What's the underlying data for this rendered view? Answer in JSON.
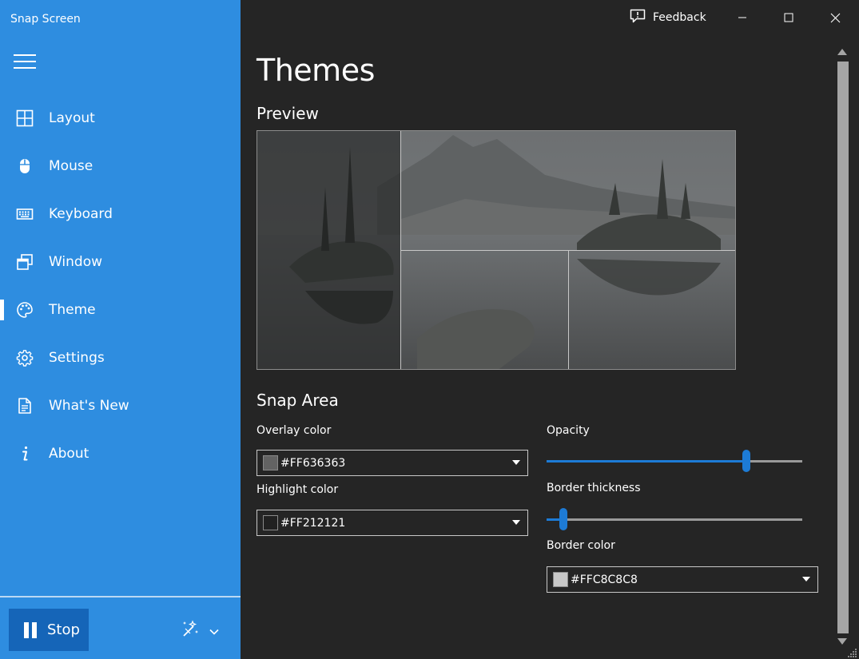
{
  "app": {
    "title": "Snap Screen"
  },
  "sidebar": {
    "items": [
      {
        "label": "Layout",
        "icon": "layout-grid-icon"
      },
      {
        "label": "Mouse",
        "icon": "mouse-icon"
      },
      {
        "label": "Keyboard",
        "icon": "keyboard-icon"
      },
      {
        "label": "Window",
        "icon": "window-icon"
      },
      {
        "label": "Theme",
        "icon": "palette-icon",
        "selected": true
      },
      {
        "label": "Settings",
        "icon": "gear-icon"
      },
      {
        "label": "What's New",
        "icon": "document-icon"
      },
      {
        "label": "About",
        "icon": "info-icon"
      }
    ],
    "stop_label": "Stop"
  },
  "titlebar": {
    "feedback_label": "Feedback"
  },
  "main": {
    "title": "Themes",
    "preview_heading": "Preview",
    "snap_area_heading": "Snap Area",
    "overlay_color": {
      "label": "Overlay color",
      "value": "#FF636363",
      "swatch": "#636363"
    },
    "highlight_color": {
      "label": "Highlight color",
      "value": "#FF212121",
      "swatch": "#212121"
    },
    "opacity": {
      "label": "Opacity",
      "level": 0.79
    },
    "border_thickness": {
      "label": "Border thickness",
      "level": 0.05
    },
    "border_color": {
      "label": "Border color",
      "value": "#FFC8C8C8",
      "swatch": "#C8C8C8"
    }
  },
  "colors": {
    "sidebar": "#2E8DE0",
    "accent": "#1D7BD6",
    "background": "#252525"
  }
}
